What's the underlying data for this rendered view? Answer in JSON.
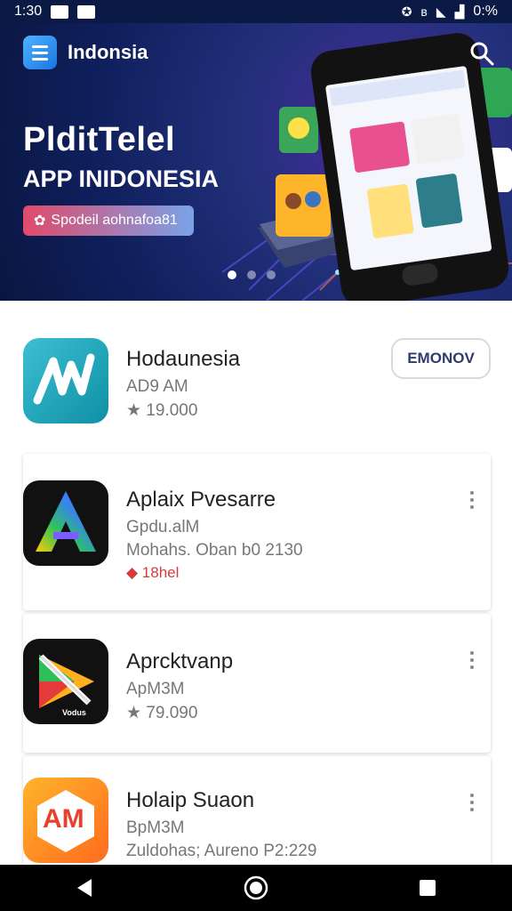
{
  "status_bar": {
    "time": "1:30",
    "battery": "0:%"
  },
  "header": {
    "title": "Indonsia"
  },
  "hero": {
    "headline": "PlditTelel",
    "subheadline": "APP INIDONESIA",
    "pill_text": "Spodeil aohnafoa81"
  },
  "apps": [
    {
      "name": "Hodaunesia",
      "line1": "AD9 AM",
      "line2": "★ 19.000",
      "action_label": "EMONOV"
    },
    {
      "name": "Aplaix Pvesarre",
      "line1": "Gpdu.alM",
      "line2": "Mohahs. Oban b0 2130",
      "line3": "◆ 18hel"
    },
    {
      "name": "Aprcktvanp",
      "line1": "ApM3M",
      "line2": "★ 79.090",
      "icon_text": "Vodus"
    },
    {
      "name": "Holaip Suaon",
      "line1": "BpM3M",
      "line2": "Zuldohas; Aureno P2:229",
      "icon_text": "AM"
    }
  ],
  "colors": {
    "banner_bg": "#0f1f5c",
    "accent_blue": "#1a75e0",
    "red_text": "#d43b3b"
  }
}
